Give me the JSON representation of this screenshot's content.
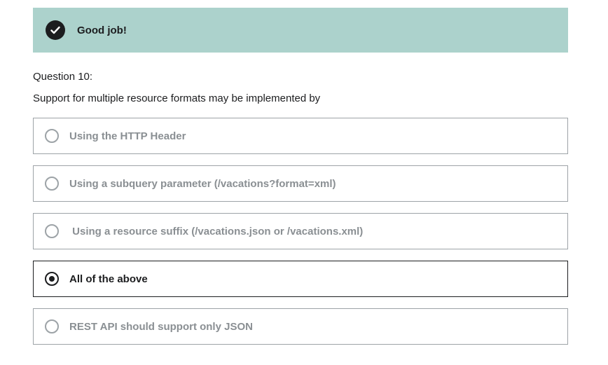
{
  "banner": {
    "icon": "check-circle-icon",
    "text": "Good job!"
  },
  "question": {
    "number_label": "Question 10:",
    "prompt": "Support for multiple resource formats may be implemented by"
  },
  "answers": [
    {
      "label": "Using the HTTP Header",
      "selected": false
    },
    {
      "label": "Using a subquery parameter (/vacations?format=xml)",
      "selected": false
    },
    {
      "label": " Using a resource suffix (/vacations.json or /vacations.xml)",
      "selected": false
    },
    {
      "label": "All of the above",
      "selected": true
    },
    {
      "label": "REST API should support only JSON",
      "selected": false
    }
  ],
  "colors": {
    "banner_bg": "#acd2cc",
    "text_dark": "#1c1d1f",
    "text_muted": "#8a8f93",
    "border_muted": "#9da3a7"
  }
}
